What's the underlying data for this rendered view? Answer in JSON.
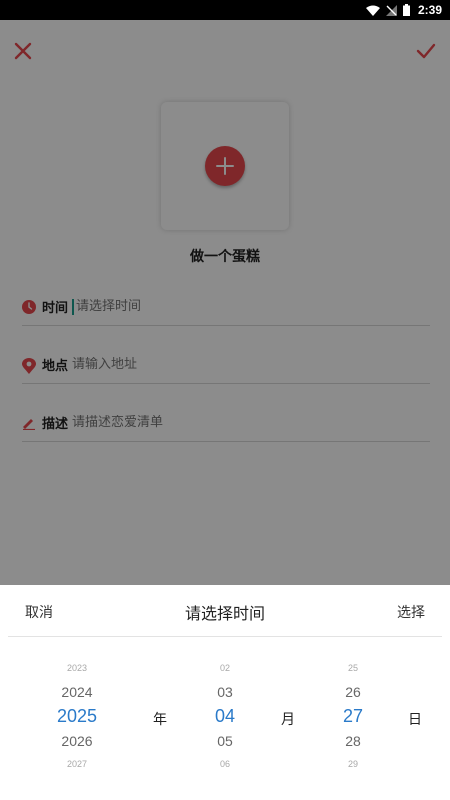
{
  "status_bar": {
    "time": "2:39"
  },
  "page": {
    "item_title": "做一个蛋糕",
    "rows": {
      "time": {
        "label": "时间",
        "placeholder": "请选择时间"
      },
      "place": {
        "label": "地点",
        "placeholder": "请输入地址"
      },
      "desc": {
        "label": "描述",
        "placeholder": "请描述恋爱清单"
      }
    }
  },
  "picker": {
    "cancel": "取消",
    "title": "请选择时间",
    "confirm": "选择",
    "year": {
      "far_prev": "2023",
      "prev": "2024",
      "selected": "2025",
      "next": "2026",
      "far_next": "2027",
      "unit": "年"
    },
    "month": {
      "far_prev": "02",
      "prev": "03",
      "selected": "04",
      "next": "05",
      "far_next": "06",
      "unit": "月"
    },
    "day": {
      "far_prev": "25",
      "prev": "26",
      "selected": "27",
      "next": "28",
      "far_next": "29",
      "unit": "日"
    }
  },
  "colors": {
    "accent": "#e8474d",
    "picker_selected": "#2a7ac9",
    "cursor": "#1a9e8f"
  }
}
